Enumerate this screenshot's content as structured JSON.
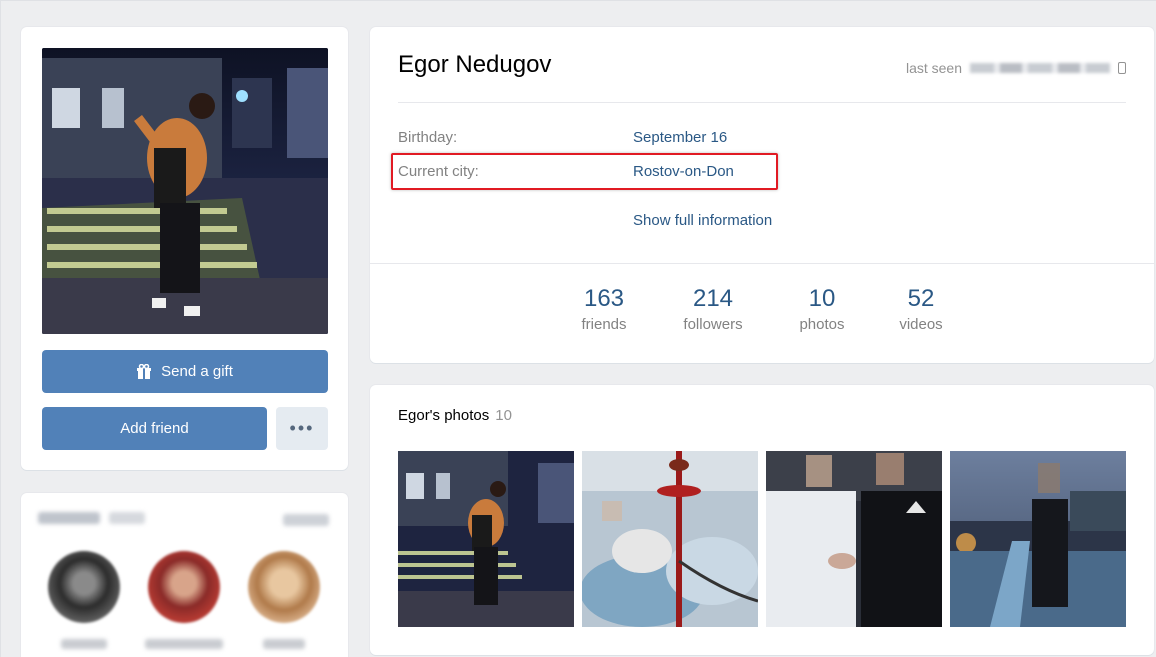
{
  "left": {
    "send_gift_label": "Send a gift",
    "add_friend_label": "Add friend",
    "more_label": "•••"
  },
  "profile": {
    "name": "Egor Nedugov",
    "last_seen_label": "last seen",
    "birthday_label": "Birthday:",
    "birthday_value": "September 16",
    "city_label": "Current city:",
    "city_value": "Rostov-on-Don",
    "show_full": "Show full information",
    "counters": [
      {
        "num": "163",
        "label": "friends"
      },
      {
        "num": "214",
        "label": "followers"
      },
      {
        "num": "10",
        "label": "photos"
      },
      {
        "num": "52",
        "label": "videos"
      }
    ]
  },
  "photos": {
    "title": "Egor's photos",
    "count": "10"
  },
  "colors": {
    "accent": "#5181b8",
    "link": "#2a5885",
    "highlight": "#e11a23",
    "background": "#edeef0"
  },
  "icons": {
    "gift": "gift-icon",
    "phone": "phone-icon",
    "more": "more-dots-icon"
  }
}
